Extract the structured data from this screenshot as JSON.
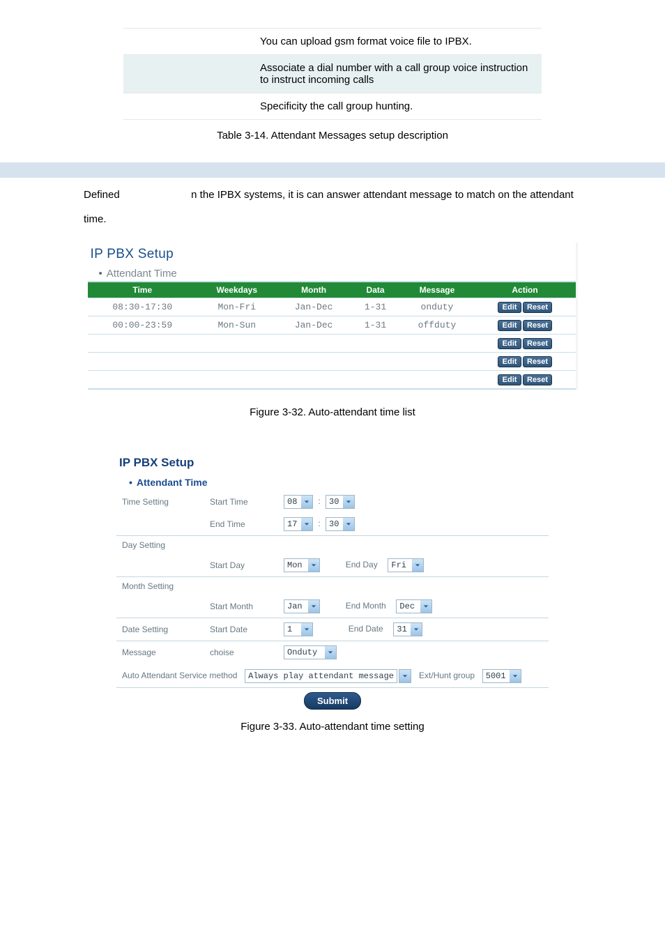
{
  "desc_rows": [
    {
      "text": "You can upload gsm format voice file to IPBX."
    },
    {
      "text": "Associate a dial number with a call group voice instruction to instruct incoming calls"
    },
    {
      "text": "Specificity the call group hunting."
    }
  ],
  "table_caption": "Table 3-14. Attendant Messages setup description",
  "body_text_prefix": "Defined",
  "body_text_rest": "n the IPBX systems, it is can answer attendant message to match on the attendant time.",
  "panel1": {
    "title": "IP PBX Setup",
    "subtitle": "Attendant Time",
    "headers": {
      "time": "Time",
      "weekdays": "Weekdays",
      "month": "Month",
      "data": "Data",
      "message": "Message",
      "action": "Action"
    },
    "rows": [
      {
        "time": "08:30-17:30",
        "weekdays": "Mon-Fri",
        "month": "Jan-Dec",
        "data": "1-31",
        "message": "onduty"
      },
      {
        "time": "00:00-23:59",
        "weekdays": "Mon-Sun",
        "month": "Jan-Dec",
        "data": "1-31",
        "message": "offduty"
      },
      {
        "time": "",
        "weekdays": "",
        "month": "",
        "data": "",
        "message": ""
      },
      {
        "time": "",
        "weekdays": "",
        "month": "",
        "data": "",
        "message": ""
      },
      {
        "time": "",
        "weekdays": "",
        "month": "",
        "data": "",
        "message": ""
      }
    ],
    "edit_label": "Edit",
    "reset_label": "Reset"
  },
  "fig1_caption": "Figure 3-32. Auto-attendant time list",
  "panel2": {
    "title": "IP PBX Setup",
    "subtitle": "Attendant Time",
    "labels": {
      "time_setting": "Time Setting",
      "start_time": "Start Time",
      "end_time": "End Time",
      "day_setting": "Day Setting",
      "start_day": "Start Day",
      "end_day": "End Day",
      "month_setting": "Month Setting",
      "start_month": "Start Month",
      "end_month": "End Month",
      "date_setting": "Date Setting",
      "start_date": "Start Date",
      "end_date": "End Date",
      "message": "Message",
      "choise": "choise",
      "auto_service": "Auto Attendant Service method",
      "ext_hunt": "Ext/Hunt group",
      "submit": "Submit"
    },
    "values": {
      "start_hour": "08",
      "start_min": "30",
      "end_hour": "17",
      "end_min": "30",
      "start_day": "Mon",
      "end_day": "Fri",
      "start_month": "Jan",
      "end_month": "Dec",
      "start_date": "1",
      "end_date": "31",
      "choise": "Onduty",
      "auto_service_val": "Always play attendant message",
      "ext_hunt_val": "5001"
    }
  },
  "fig2_caption": "Figure 3-33. Auto-attendant time setting"
}
